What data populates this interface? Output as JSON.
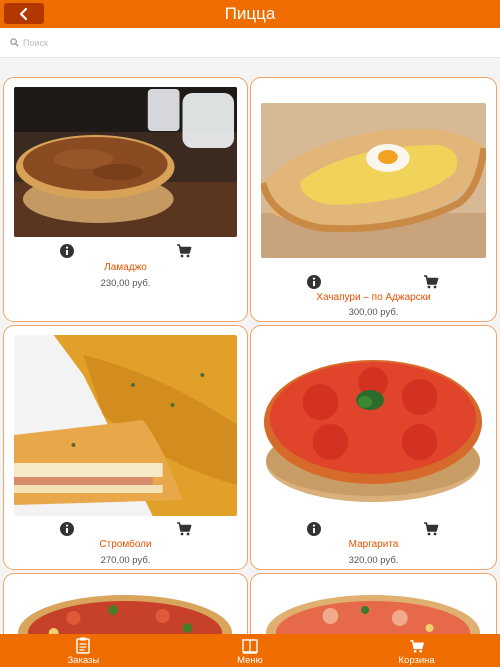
{
  "header": {
    "title": "Пицца"
  },
  "search": {
    "placeholder": "Поиск"
  },
  "products": [
    {
      "name": "Ламаджо",
      "price": "230,00 руб."
    },
    {
      "name": "Хачапури – по Аджарски",
      "price": "300,00 руб."
    },
    {
      "name": "Стромболи",
      "price": "270,00 руб."
    },
    {
      "name": "Маргарита",
      "price": "320,00 руб."
    }
  ],
  "bottom_nav": [
    {
      "label": "Заказы",
      "icon": "clipboard-icon"
    },
    {
      "label": "Меню",
      "icon": "book-icon"
    },
    {
      "label": "Корзина",
      "icon": "cart-icon"
    }
  ],
  "colors": {
    "accent": "#ef6c00",
    "back_button": "#b23800",
    "card_border": "#f0a468",
    "product_name": "#e65100"
  }
}
